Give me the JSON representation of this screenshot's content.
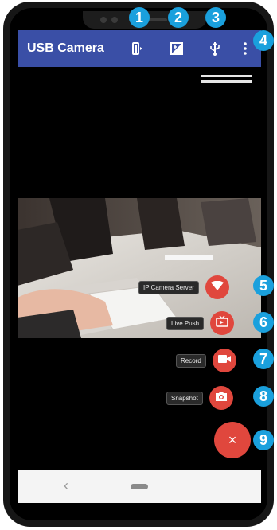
{
  "app": {
    "title": "USB Camera"
  },
  "appbar_icons": [
    "camera-switch-icon",
    "brightness-icon",
    "usb-icon",
    "more-vert-icon"
  ],
  "fab_actions": [
    {
      "label": "IP Camera Server",
      "icon": "wifi-icon"
    },
    {
      "label": "Live Push",
      "icon": "live-tv-icon"
    },
    {
      "label": "Record",
      "icon": "videocam-icon"
    },
    {
      "label": "Snapshot",
      "icon": "camera-icon"
    }
  ],
  "close_fab": {
    "symbol": "×"
  },
  "navbar": {
    "back_symbol": "‹"
  },
  "badges": [
    "1",
    "2",
    "3",
    "4",
    "5",
    "6",
    "7",
    "8",
    "9"
  ],
  "colors": {
    "appbar": "#3a4fa6",
    "fab": "#e0473d",
    "badge": "#1aa0dd"
  }
}
